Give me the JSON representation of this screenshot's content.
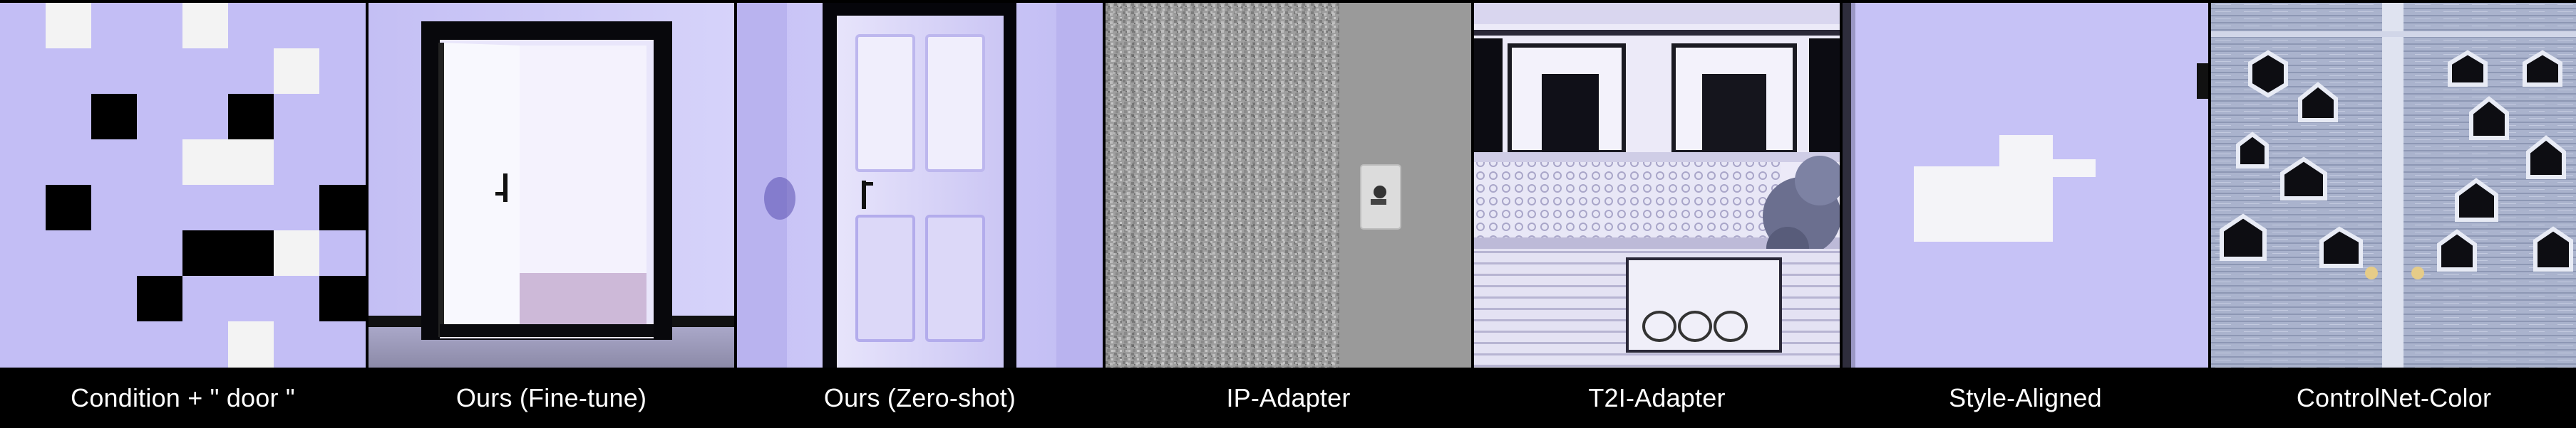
{
  "panels": [
    {
      "caption": "Condition + \" door \""
    },
    {
      "caption": "Ours (Fine-tune)"
    },
    {
      "caption": "Ours (Zero-shot)"
    },
    {
      "caption": "IP-Adapter"
    },
    {
      "caption": "T2I-Adapter"
    },
    {
      "caption": "Style-Aligned"
    },
    {
      "caption": "ControlNet-Color"
    }
  ],
  "colors": {
    "background": "#000000",
    "caption_text": "#ffffff",
    "lavender": "#c5c0f6",
    "black_block": "#000000",
    "white_block": "#f2f2f2"
  }
}
